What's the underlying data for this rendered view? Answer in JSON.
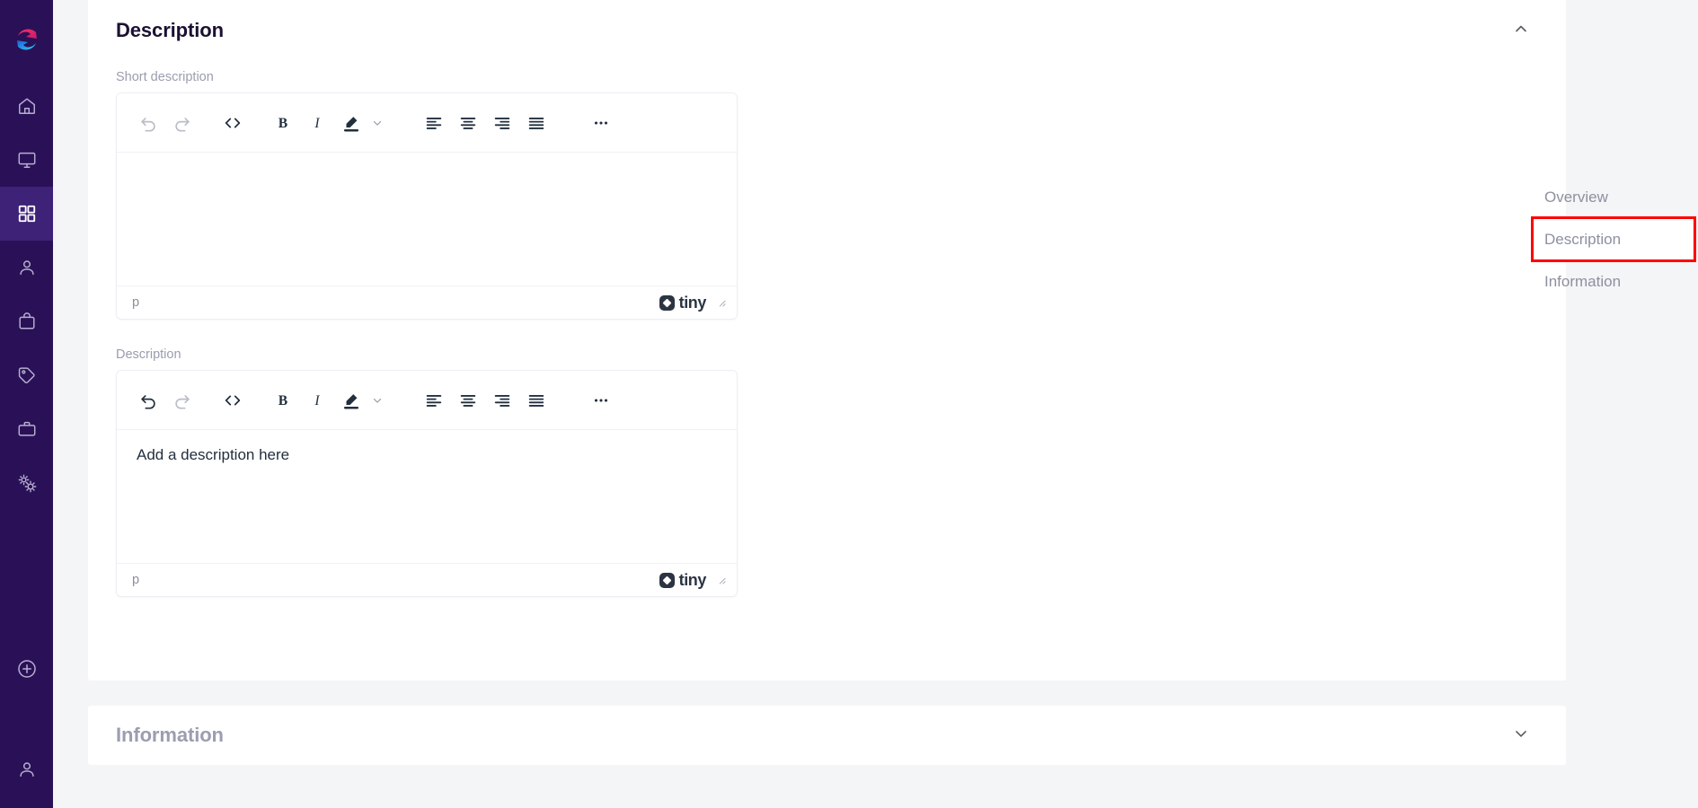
{
  "app": {
    "accent_purple": "#2a1157",
    "accent_purple_active": "#3e2278",
    "highlight_red": "#ff0000",
    "page_background": "#f4f5f7"
  },
  "sidebar": {
    "logo_name": "app-logo",
    "items": [
      {
        "icon": "home-icon",
        "name": "sidebar-item-home",
        "active": false
      },
      {
        "icon": "monitor-icon",
        "name": "sidebar-item-monitor",
        "active": false
      },
      {
        "icon": "grid-icon",
        "name": "sidebar-item-catalog",
        "active": true
      },
      {
        "icon": "user-icon",
        "name": "sidebar-item-customers",
        "active": false
      },
      {
        "icon": "bag-icon",
        "name": "sidebar-item-orders",
        "active": false
      },
      {
        "icon": "tag-icon",
        "name": "sidebar-item-pricing",
        "active": false
      },
      {
        "icon": "briefcase-icon",
        "name": "sidebar-item-business",
        "active": false
      },
      {
        "icon": "cogs-icon",
        "name": "sidebar-item-settings",
        "active": false
      }
    ],
    "bottom_items": [
      {
        "icon": "plus-circle-icon",
        "name": "sidebar-add-button"
      },
      {
        "icon": "account-icon",
        "name": "sidebar-account-button"
      }
    ]
  },
  "description_section": {
    "title": "Description",
    "collapse_icon": "chevron-up-icon",
    "expanded": true,
    "fields": [
      {
        "label": "Short description",
        "editor_name": "short-description-editor",
        "content": "",
        "status_path": "p",
        "brand": "tiny"
      },
      {
        "label": "Description",
        "editor_name": "description-editor",
        "content": "Add a description here",
        "status_path": "p",
        "brand": "tiny"
      }
    ],
    "toolbar": [
      {
        "name": "undo-icon",
        "label": "Undo",
        "disabled": true
      },
      {
        "name": "redo-icon",
        "label": "Redo",
        "disabled": true
      },
      {
        "name": "source-code-icon",
        "label": "Source code",
        "disabled": false
      },
      {
        "name": "bold-icon",
        "label": "Bold",
        "disabled": false
      },
      {
        "name": "italic-icon",
        "label": "Italic",
        "disabled": false
      },
      {
        "name": "highlight-color-icon",
        "label": "Text highlight color",
        "disabled": false
      },
      {
        "name": "chevron-down-icon",
        "label": "More colors",
        "disabled": false
      },
      {
        "name": "align-left-icon",
        "label": "Align left",
        "disabled": false
      },
      {
        "name": "align-center-icon",
        "label": "Align center",
        "disabled": false
      },
      {
        "name": "align-right-icon",
        "label": "Align right",
        "disabled": false
      },
      {
        "name": "align-justify-icon",
        "label": "Justify",
        "disabled": false
      },
      {
        "name": "more-icon",
        "label": "More...",
        "disabled": false
      }
    ]
  },
  "information_section": {
    "title": "Information",
    "collapse_icon": "chevron-down-icon",
    "expanded": false
  },
  "right_nav": {
    "items": [
      {
        "label": "Overview",
        "name": "right-nav-overview",
        "highlighted": false
      },
      {
        "label": "Description",
        "name": "right-nav-description",
        "highlighted": true
      },
      {
        "label": "Information",
        "name": "right-nav-information",
        "highlighted": false
      }
    ]
  }
}
